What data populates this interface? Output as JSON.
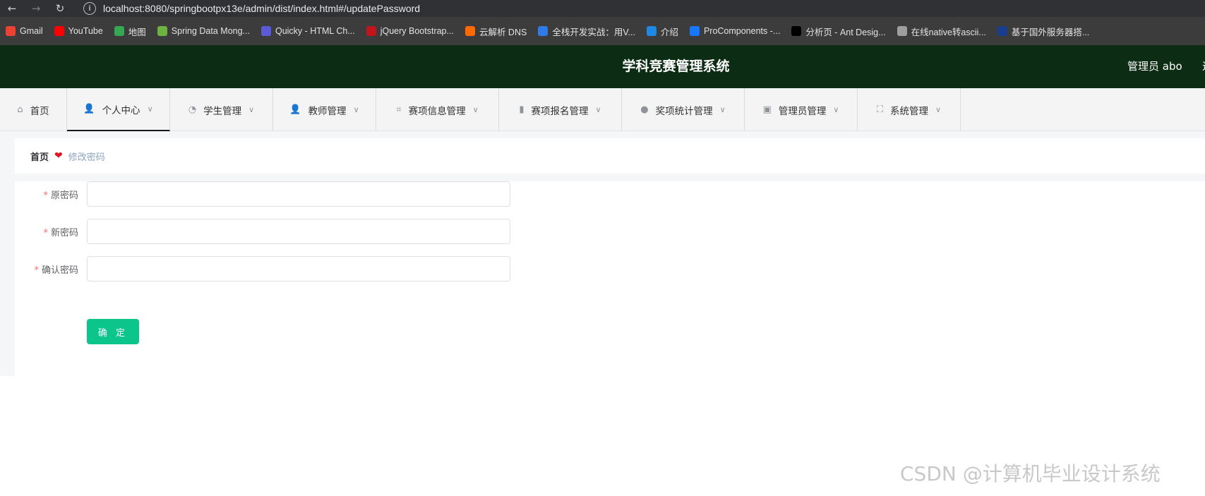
{
  "browser": {
    "url": "localhost:8080/springbootpx13e/admin/dist/index.html#/updatePassword",
    "bookmarks": [
      {
        "label": "Gmail",
        "icon": "gmail-icon",
        "color": "#ea4335"
      },
      {
        "label": "YouTube",
        "icon": "youtube-icon",
        "color": "#ff0000"
      },
      {
        "label": "地图",
        "icon": "maps-icon",
        "color": "#34a853"
      },
      {
        "label": "Spring Data Mong...",
        "icon": "spring-icon",
        "color": "#6db33f"
      },
      {
        "label": "Quicky - HTML Ch...",
        "icon": "messenger-icon",
        "color": "#5b5bd6"
      },
      {
        "label": "jQuery Bootstrap...",
        "icon": "jquery-icon",
        "color": "#c0151b"
      },
      {
        "label": "云解析 DNS",
        "icon": "aliyun-icon",
        "color": "#ff6a00"
      },
      {
        "label": "全栈开发实战：用V...",
        "icon": "m-icon",
        "color": "#2f7ae5"
      },
      {
        "label": "介绍",
        "icon": "globe-blue-icon",
        "color": "#1e88e5"
      },
      {
        "label": "ProComponents -...",
        "icon": "antd-icon",
        "color": "#1677ff"
      },
      {
        "label": "分析页 - Ant Desig...",
        "icon": "pro-icon",
        "color": "#000000"
      },
      {
        "label": "在线native转ascii...",
        "icon": "globe-icon",
        "color": "#9e9e9e"
      },
      {
        "label": "基于国外服务器搭...",
        "icon": "flag-icon",
        "color": "#1a3c8c"
      }
    ]
  },
  "header": {
    "title": "学科竞赛管理系统",
    "user": "管理员 abo",
    "cut_text": "退"
  },
  "menu": [
    {
      "label": "首页",
      "icon": "home-icon",
      "glyph": "⌂",
      "has_dropdown": false,
      "active": false
    },
    {
      "label": "个人中心",
      "icon": "user-icon",
      "glyph": "👤",
      "has_dropdown": true,
      "active": true
    },
    {
      "label": "学生管理",
      "icon": "gauge-icon",
      "glyph": "◔",
      "has_dropdown": true,
      "active": false
    },
    {
      "label": "教师管理",
      "icon": "user-icon",
      "glyph": "👤",
      "has_dropdown": true,
      "active": false
    },
    {
      "label": "赛项信息管理",
      "icon": "crop-icon",
      "glyph": "⌗",
      "has_dropdown": true,
      "active": false
    },
    {
      "label": "赛项报名管理",
      "icon": "bar-chart-icon",
      "glyph": "▮",
      "has_dropdown": true,
      "active": false
    },
    {
      "label": "奖项统计管理",
      "icon": "balloon-icon",
      "glyph": "●",
      "has_dropdown": true,
      "active": false
    },
    {
      "label": "管理员管理",
      "icon": "clipboard-icon",
      "glyph": "▣",
      "has_dropdown": true,
      "active": false
    },
    {
      "label": "系统管理",
      "icon": "fullscreen-icon",
      "glyph": "⛶",
      "has_dropdown": true,
      "active": false
    }
  ],
  "breadcrumb": {
    "home": "首页",
    "current": "修改密码"
  },
  "form": {
    "fields": [
      {
        "label": "原密码",
        "required": "*",
        "value": ""
      },
      {
        "label": "新密码",
        "required": "*",
        "value": ""
      },
      {
        "label": "确认密码",
        "required": "*",
        "value": ""
      }
    ],
    "submit_label": "确 定"
  },
  "watermark": "CSDN @计算机毕业设计系统",
  "colors": {
    "header_bg": "#0c2c14",
    "submit_bg": "#0bc58b",
    "required": "#f56c6c",
    "breadcrumb_heart": "#e0141e"
  }
}
